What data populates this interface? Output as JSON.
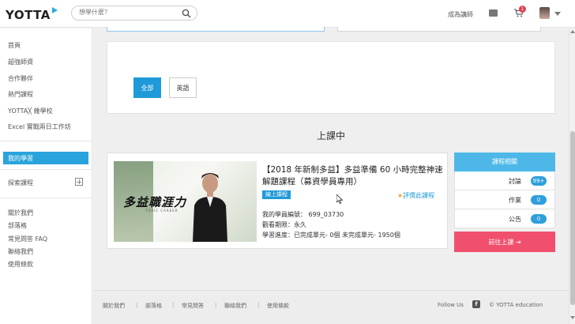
{
  "header": {
    "logo": "YOTTA",
    "search_placeholder": "想學什麼？",
    "become_instructor": "成為講師",
    "cart_count": "1"
  },
  "sidebar": {
    "items": [
      "首頁",
      "超強師資",
      "合作夥伴",
      "熱門課程",
      "YOTTA╳ 雜學校",
      "Excel 實戰兩日工作坊"
    ],
    "my_learning": "我的學習",
    "explore": "探索課程",
    "bottom_items": [
      "關於我們",
      "部落格",
      "常見問答 FAQ",
      "聯絡我們",
      "使用條款"
    ]
  },
  "filter": {
    "all_label": "全部",
    "english_label": "英語"
  },
  "section_title": "上課中",
  "course": {
    "thumb_title": "多益職涯力",
    "thumb_sub": "TOEIC  CAREER",
    "title": "【2018 年新制多益】多益準備 60 小時完整神速解題課程（募資學員專用）",
    "badge": "線上課程",
    "rate_label": "評價此課程",
    "student_no": "我的學員編號： 699_03730",
    "period": "觀看期限：永久",
    "progress": "學習進度：已完成單元- 0個 未完成單元- 1950個"
  },
  "panel": {
    "header": "課程相關",
    "rows": [
      {
        "label": "討論",
        "count": "99+"
      },
      {
        "label": "作業",
        "count": "0"
      },
      {
        "label": "公告",
        "count": "0"
      }
    ],
    "go_label": "前往上課"
  },
  "footer": {
    "links": [
      "關於我們",
      "部落格",
      "常見問答",
      "聯絡我們",
      "使用條款"
    ],
    "follow": "Follow Us",
    "copyright": "© YOTTA education"
  }
}
